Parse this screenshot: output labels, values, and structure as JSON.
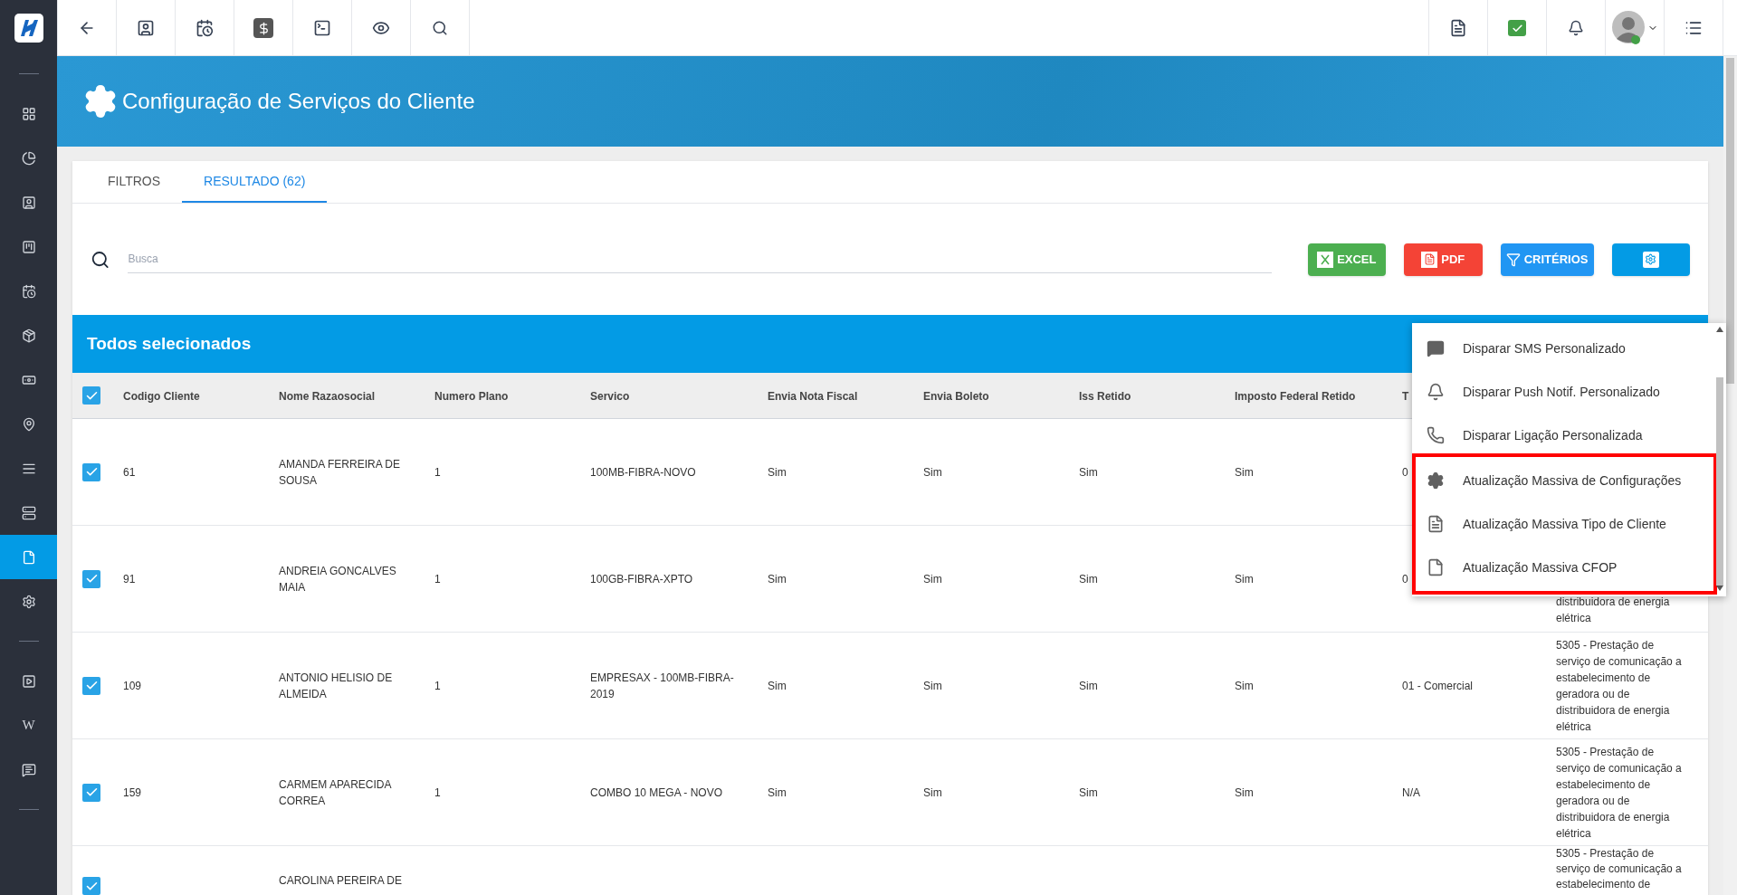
{
  "sidebar": {
    "groups": [
      [
        {
          "selected": false
        },
        {
          "selected": false
        },
        {
          "selected": false
        },
        {
          "selected": false
        },
        {
          "selected": false
        },
        {
          "selected": false
        },
        {
          "selected": false
        },
        {
          "selected": false
        },
        {
          "selected": false
        },
        {
          "selected": false
        },
        {
          "selected": true
        },
        {
          "selected": false
        }
      ],
      [
        {
          "selected": false
        },
        {
          "kind": "text",
          "label": "W",
          "selected": false
        },
        {
          "selected": false
        }
      ]
    ]
  },
  "page": {
    "title": "Configuração de Serviços do Cliente"
  },
  "tabs": [
    {
      "label": "FILTROS",
      "selected": false
    },
    {
      "label": "RESULTADO (62)",
      "selected": true
    }
  ],
  "search": {
    "placeholder": "Busca"
  },
  "buttons": [
    {
      "kind": "excel",
      "label": "EXCEL"
    },
    {
      "kind": "pdf",
      "label": "PDF"
    },
    {
      "kind": "criteria",
      "label": "CRITÉRIOS"
    },
    {
      "kind": "settings"
    }
  ],
  "selection_bar": {
    "title": "Todos selecionados"
  },
  "table": {
    "all_checked": true,
    "columns": [
      "Codigo Cliente",
      "Nome Razaosocial",
      "Numero Plano",
      "Servico",
      "Envia Nota Fiscal",
      "Envia Boleto",
      "Iss Retido",
      "Imposto Federal Retido",
      "T",
      null
    ],
    "rows": [
      {
        "checked": true,
        "cells": [
          "61",
          "AMANDA FERREIRA DE SOUSA",
          "1",
          "100MB-FIBRA-NOVO",
          "Sim",
          "Sim",
          "Sim",
          "Sim",
          "0",
          null
        ]
      },
      {
        "checked": true,
        "cells": [
          "91",
          "ANDREIA GONCALVES MAIA",
          "1",
          "100GB-FIBRA-XPTO",
          "Sim",
          "Sim",
          "Sim",
          "Sim",
          "0",
          "distribuidora de energia elétrica"
        ]
      },
      {
        "checked": true,
        "cells": [
          "109",
          "ANTONIO HELISIO DE ALMEIDA",
          "1",
          "EMPRESAX - 100MB-FIBRA-2019",
          "Sim",
          "Sim",
          "Sim",
          "Sim",
          "01 - Comercial",
          "5305 - Prestação de serviço de comunicação a estabelecimento de geradora ou de distribuidora de energia elétrica"
        ]
      },
      {
        "checked": true,
        "cells": [
          "159",
          "CARMEM APARECIDA CORREA",
          "1",
          "COMBO 10 MEGA - NOVO",
          "Sim",
          "Sim",
          "Sim",
          "Sim",
          "N/A",
          "5305 - Prestação de serviço de comunicação a estabelecimento de geradora ou de distribuidora de energia elétrica"
        ]
      },
      {
        "checked": true,
        "kind": "partial",
        "cells": [
          null,
          "CAROLINA PEREIRA DE",
          null,
          null,
          null,
          null,
          null,
          null,
          null,
          "5305 - Prestação de serviço de comunicação a estabelecimento de"
        ]
      }
    ]
  },
  "menu": {
    "items": [
      {
        "label": "Disparar SMS Personalizado",
        "highlighted": false
      },
      {
        "label": "Disparar Push Notif. Personalizado",
        "highlighted": false
      },
      {
        "label": "Disparar Ligação Personalizada",
        "highlighted": false
      },
      {
        "label": "Atualização Massiva de Configurações",
        "highlighted": true
      },
      {
        "label": "Atualização Massiva Tipo de Cliente",
        "highlighted": true
      },
      {
        "label": "Atualização Massiva CFOP",
        "highlighted": true
      }
    ]
  }
}
